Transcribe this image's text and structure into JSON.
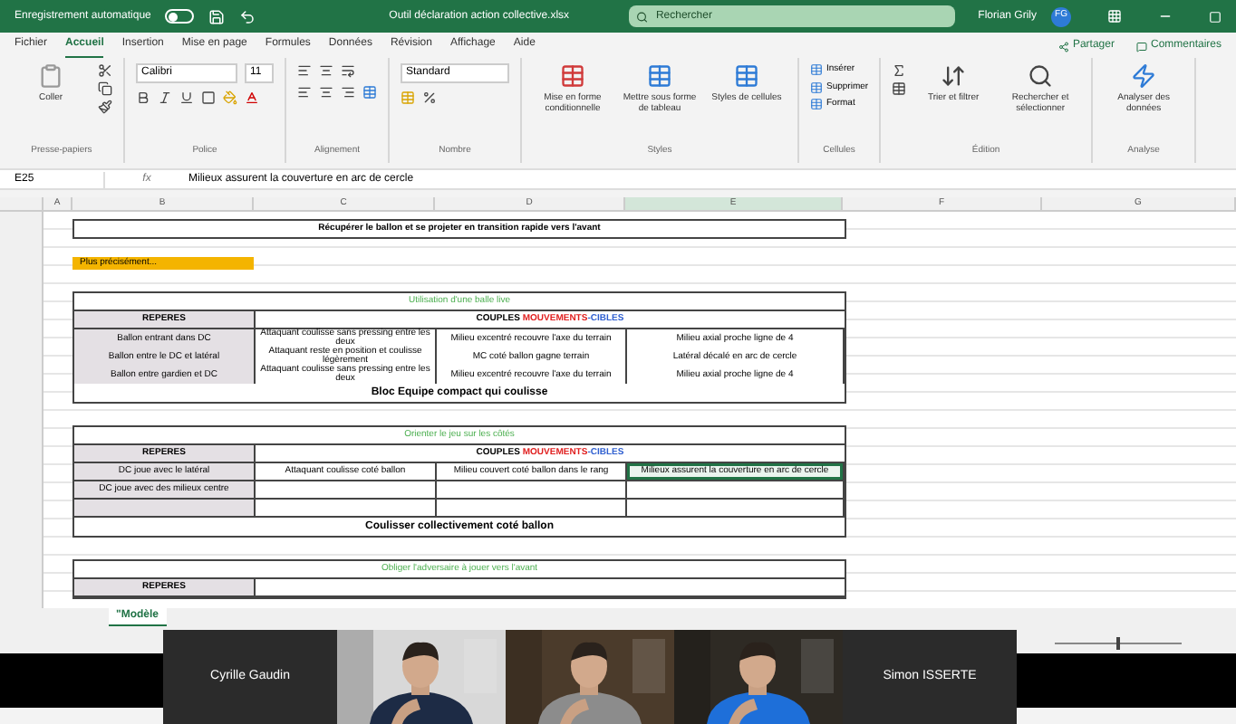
{
  "title_bar": {
    "autosave_label": "Enregistrement automatique",
    "autosave": {
      "on": false
    },
    "file_name": "Outil déclaration action collective.xlsx",
    "search": {
      "placeholder": "Rechercher"
    },
    "user_name": "Florian Grily",
    "initials": "FG"
  },
  "menu": {
    "tabs": [
      {
        "label": "Fichier",
        "selected": false
      },
      {
        "label": "Accueil",
        "selected": true
      },
      {
        "label": "Insertion",
        "selected": false
      },
      {
        "label": "Mise en page",
        "selected": false
      },
      {
        "label": "Formules",
        "selected": false
      },
      {
        "label": "Données",
        "selected": false
      },
      {
        "label": "Révision",
        "selected": false
      },
      {
        "label": "Affichage",
        "selected": false
      },
      {
        "label": "Aide",
        "selected": false
      }
    ],
    "share": "Partager",
    "comments": "Commentaires"
  },
  "ribbon": [
    {
      "kind": "clipboard",
      "label": "Presse-papiers",
      "buttons": [
        "Coller"
      ]
    },
    {
      "kind": "font",
      "label": "Police",
      "font": "Calibri",
      "size": "11"
    },
    {
      "kind": "alignment",
      "label": "Alignement"
    },
    {
      "kind": "number",
      "label": "Nombre",
      "format": "Standard"
    },
    {
      "kind": "styles",
      "label": "Styles",
      "buttons": [
        "Mise en forme conditionnelle",
        "Mettre sous forme de tableau",
        "Styles de cellules"
      ]
    },
    {
      "kind": "cells",
      "label": "Cellules",
      "buttons": [
        "Insérer",
        "Supprimer",
        "Format"
      ]
    },
    {
      "kind": "editing",
      "label": "Édition",
      "buttons": [
        "Trier et filtrer",
        "Rechercher et sélectionner"
      ]
    },
    {
      "kind": "analysis",
      "label": "Analyse",
      "buttons": [
        "Analyser des données"
      ]
    }
  ],
  "formula_bar": {
    "cell": "E25",
    "function_symbol": "fx",
    "value": "Milieux assurent la couverture en arc de cercle"
  },
  "sheet": {
    "columns": [
      "A",
      "B",
      "C",
      "D",
      "E",
      "F",
      "G"
    ],
    "blocks": [
      {
        "kind": "banner",
        "text": "Récupérer le ballon et se projeter en transition rapide vers l'avant"
      },
      {
        "kind": "highlight",
        "text": "Plus précisément..."
      },
      {
        "kind": "table",
        "title": "Utilisation d'une balle live",
        "corner": "REPERES",
        "heading": [
          {
            "text": "COUPLES ",
            "color": "#000000"
          },
          {
            "text": "MOUVEMENTS",
            "color": "#e02020"
          },
          {
            "text": "-CIBLES",
            "color": "#2f5fd0"
          }
        ],
        "rows": [
          {
            "label": "Ballon entrant dans DC",
            "cells": [
              {
                "text": "Attaquant coulisse sans pressing entre les deux",
                "selected": false
              },
              {
                "text": "Milieu excentré recouvre l'axe du terrain",
                "selected": false
              },
              {
                "text": "Milieu axial proche ligne de 4",
                "selected": false
              }
            ]
          },
          {
            "label": "Ballon entre le DC et latéral",
            "cells": [
              {
                "text": "Attaquant reste en position et coulisse légèrement",
                "selected": false
              },
              {
                "text": "MC coté ballon gagne terrain",
                "selected": false
              },
              {
                "text": "Latéral décalé en arc de cercle",
                "selected": false
              }
            ]
          },
          {
            "label": "Ballon entre gardien et DC",
            "cells": [
              {
                "text": "Attaquant coulisse sans pressing entre les deux",
                "selected": false
              },
              {
                "text": "Milieu excentré recouvre l'axe du terrain",
                "selected": false
              },
              {
                "text": "Milieu axial proche ligne de 4",
                "selected": false
              }
            ]
          }
        ],
        "footer": "Bloc Equipe compact qui coulisse"
      },
      {
        "kind": "table",
        "title": "Orienter le jeu sur les côtés",
        "corner": "REPERES",
        "heading": [
          {
            "text": "COUPLES ",
            "color": "#000000"
          },
          {
            "text": "MOUVEMENTS",
            "color": "#e02020"
          },
          {
            "text": "-CIBLES",
            "color": "#2f5fd0"
          }
        ],
        "rows": [
          {
            "label": "DC joue avec le latéral",
            "cells": [
              {
                "text": "Attaquant coulisse coté ballon",
                "selected": false
              },
              {
                "text": "Milieu couvert coté ballon dans le rang",
                "selected": false
              },
              {
                "text": "Milieux assurent la couverture en arc de cercle",
                "selected": true
              }
            ]
          },
          {
            "label": "DC joue avec des milieux centre",
            "cells": [
              {
                "text": "",
                "selected": false
              },
              {
                "text": "",
                "selected": false
              },
              {
                "text": "",
                "selected": false
              }
            ]
          },
          {
            "label": "",
            "cells": [
              {
                "text": "",
                "selected": false
              },
              {
                "text": "",
                "selected": false
              },
              {
                "text": "",
                "selected": false
              }
            ]
          }
        ],
        "footer": "Coulisser collectivement coté ballon"
      },
      {
        "kind": "table",
        "title": "Obliger l'adversaire à jouer vers l'avant",
        "corner": "REPERES"
      }
    ]
  },
  "sheet_tabs": [
    {
      "label": "\"Modèle",
      "selected": true
    }
  ],
  "status_bar": {
    "zoom": {
      "level": 0.5
    }
  },
  "participants": [
    {
      "kind": "name",
      "name": "Cyrille Gaudin"
    },
    {
      "kind": "video"
    },
    {
      "kind": "video"
    },
    {
      "kind": "video"
    },
    {
      "kind": "name",
      "name": "Simon ISSERTE"
    }
  ]
}
